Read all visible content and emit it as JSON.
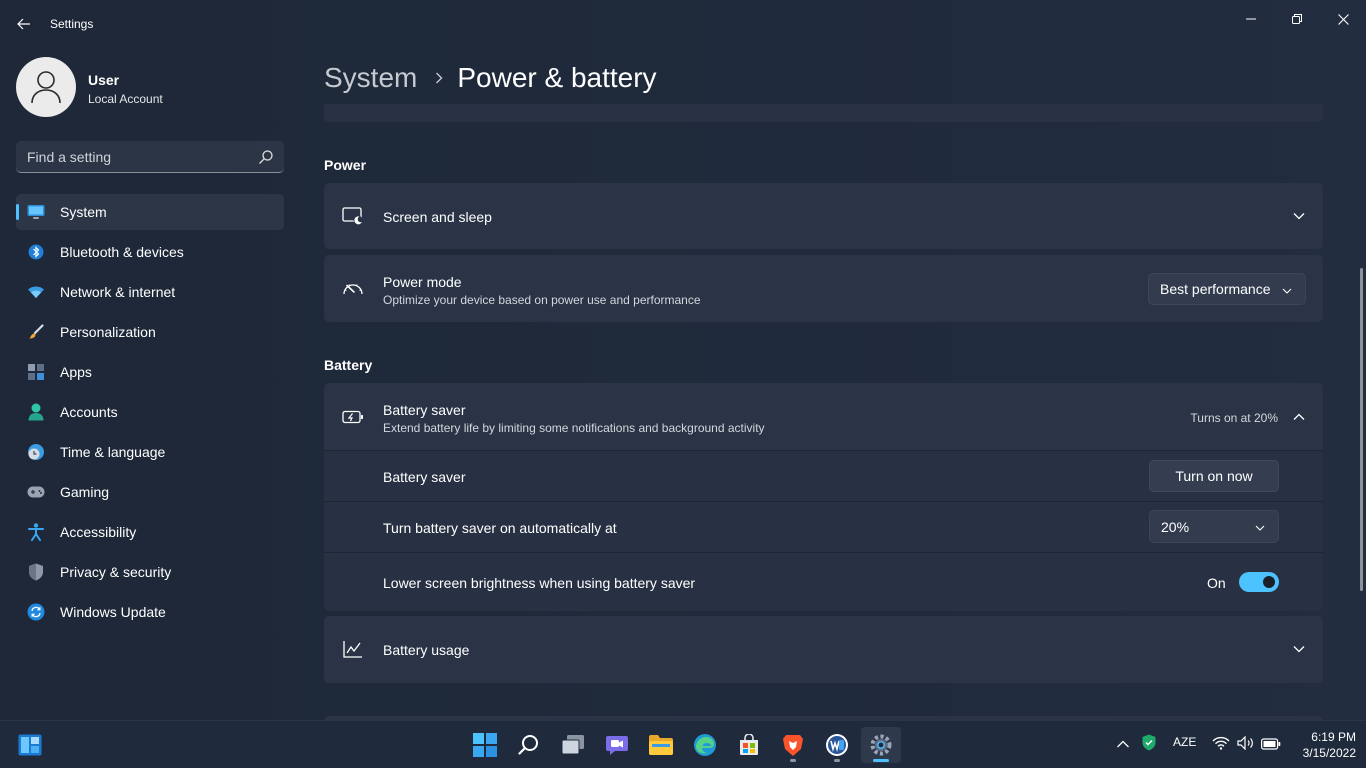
{
  "window": {
    "title": "Settings"
  },
  "user": {
    "name": "User",
    "account_type": "Local Account"
  },
  "search": {
    "placeholder": "Find a setting"
  },
  "nav": [
    {
      "label": "System",
      "icon": "monitor-icon",
      "selected": true
    },
    {
      "label": "Bluetooth & devices",
      "icon": "bluetooth-icon"
    },
    {
      "label": "Network & internet",
      "icon": "wifi-icon"
    },
    {
      "label": "Personalization",
      "icon": "brush-icon"
    },
    {
      "label": "Apps",
      "icon": "apps-icon"
    },
    {
      "label": "Accounts",
      "icon": "person-icon"
    },
    {
      "label": "Time & language",
      "icon": "clock-globe-icon"
    },
    {
      "label": "Gaming",
      "icon": "gamepad-icon"
    },
    {
      "label": "Accessibility",
      "icon": "accessibility-icon"
    },
    {
      "label": "Privacy & security",
      "icon": "shield-icon"
    },
    {
      "label": "Windows Update",
      "icon": "update-icon"
    }
  ],
  "breadcrumb": {
    "parent": "System",
    "current": "Power & battery"
  },
  "power": {
    "section_title": "Power",
    "screen_sleep": {
      "title": "Screen and sleep",
      "icon": "screen-sleep-icon"
    },
    "power_mode": {
      "title": "Power mode",
      "subtitle": "Optimize your device based on power use and performance",
      "value": "Best performance",
      "icon": "gauge-icon"
    }
  },
  "battery": {
    "section_title": "Battery",
    "saver": {
      "title": "Battery saver",
      "subtitle": "Extend battery life by limiting some notifications and background activity",
      "status": "Turns on at 20%",
      "icon": "battery-saver-icon",
      "expanded": true,
      "rows": {
        "saver_label": "Battery saver",
        "turn_on_button": "Turn on now",
        "auto_label": "Turn battery saver on automatically at",
        "auto_value": "20%",
        "brightness_label": "Lower screen brightness when using battery saver",
        "brightness_state": "On",
        "brightness_on": true
      }
    },
    "usage": {
      "title": "Battery usage",
      "icon": "chart-line-icon"
    }
  },
  "taskbar": {
    "apps": [
      {
        "name": "windows-logo-icon"
      },
      {
        "name": "search-icon"
      },
      {
        "name": "task-view-icon"
      },
      {
        "name": "chat-icon"
      },
      {
        "name": "file-explorer-icon"
      },
      {
        "name": "edge-icon"
      },
      {
        "name": "store-icon"
      },
      {
        "name": "brave-icon",
        "running": true
      },
      {
        "name": "word-icon",
        "running": true
      },
      {
        "name": "settings-icon",
        "running": true,
        "active": true
      }
    ],
    "tray": {
      "language": "AZE"
    },
    "clock": {
      "time": "6:19 PM",
      "date": "3/15/2022"
    }
  },
  "colors": {
    "accent": "#4cc2ff",
    "background": "#1f2a3c",
    "card": "#2a3446"
  }
}
